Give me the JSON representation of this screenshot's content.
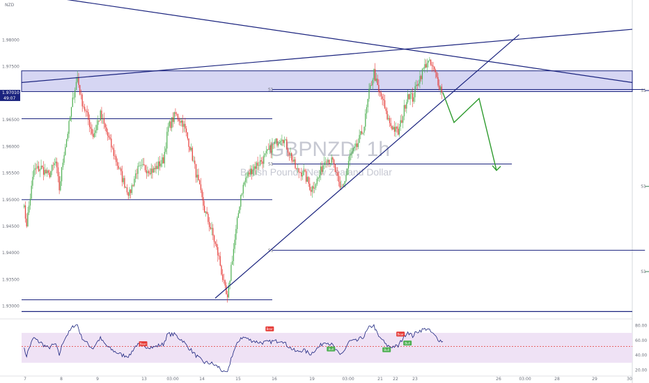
{
  "chart_data": {
    "type": "candlestick",
    "symbol": "GBPNZD, 1h",
    "description": "British Pound / New Zealand Dollar",
    "currency": "NZD",
    "price_axis": {
      "range": [
        1.928,
        1.9875
      ],
      "ticks": [
        "1.98000",
        "1.97500",
        "1.96500",
        "1.96000",
        "1.95500",
        "1.95000",
        "1.94500",
        "1.94000",
        "1.93500",
        "1.93000"
      ],
      "tick_values": [
        1.98,
        1.975,
        1.965,
        1.96,
        1.955,
        1.95,
        1.945,
        1.94,
        1.935,
        1.93
      ],
      "current_price": "1.97010",
      "current_price_value": 1.9701,
      "countdown": "49:07"
    },
    "time_axis": {
      "ticks": [
        "7",
        "8",
        "9",
        "13",
        "03:00",
        "14",
        "15",
        "16",
        "19",
        "03:00",
        "21",
        "22",
        "23",
        "26",
        "03:00",
        "28",
        "29",
        "30"
      ]
    },
    "price_path": [
      [
        0,
        1.9495
      ],
      [
        3,
        1.9455
      ],
      [
        9,
        1.9555
      ],
      [
        15,
        1.956
      ],
      [
        21,
        1.9545
      ],
      [
        27,
        1.957
      ],
      [
        30,
        1.952
      ],
      [
        34,
        1.959
      ],
      [
        38,
        1.964
      ],
      [
        42,
        1.97
      ],
      [
        45,
        1.973
      ],
      [
        48,
        1.969
      ],
      [
        54,
        1.965
      ],
      [
        58,
        1.962
      ],
      [
        64,
        1.966
      ],
      [
        70,
        1.962
      ],
      [
        76,
        1.958
      ],
      [
        82,
        1.954
      ],
      [
        88,
        1.951
      ],
      [
        94,
        1.9555
      ],
      [
        100,
        1.956
      ],
      [
        108,
        1.9555
      ],
      [
        116,
        1.9575
      ],
      [
        120,
        1.9635
      ],
      [
        126,
        1.966
      ],
      [
        132,
        1.9645
      ],
      [
        138,
        1.96
      ],
      [
        144,
        1.954
      ],
      [
        150,
        1.948
      ],
      [
        156,
        1.944
      ],
      [
        162,
        1.939
      ],
      [
        166,
        1.934
      ],
      [
        169,
        1.931
      ],
      [
        172,
        1.9375
      ],
      [
        176,
        1.944
      ],
      [
        180,
        1.951
      ],
      [
        184,
        1.954
      ],
      [
        190,
        1.956
      ],
      [
        198,
        1.9575
      ],
      [
        206,
        1.96
      ],
      [
        214,
        1.962
      ],
      [
        220,
        1.959
      ],
      [
        226,
        1.9555
      ],
      [
        232,
        1.955
      ],
      [
        238,
        1.952
      ],
      [
        244,
        1.954
      ],
      [
        250,
        1.958
      ],
      [
        256,
        1.957
      ],
      [
        262,
        1.952
      ],
      [
        266,
        1.9535
      ],
      [
        270,
        1.958
      ],
      [
        276,
        1.96
      ],
      [
        282,
        1.964
      ],
      [
        286,
        1.97
      ],
      [
        290,
        1.974
      ],
      [
        294,
        1.97
      ],
      [
        297,
        1.969
      ],
      [
        300,
        1.966
      ],
      [
        304,
        1.964
      ],
      [
        310,
        1.9625
      ],
      [
        314,
        1.966
      ],
      [
        318,
        1.97
      ],
      [
        322,
        1.969
      ],
      [
        326,
        1.972
      ],
      [
        330,
        1.974
      ],
      [
        334,
        1.976
      ],
      [
        338,
        1.975
      ],
      [
        341,
        1.9735
      ],
      [
        344,
        1.9715
      ],
      [
        347,
        1.9701
      ]
    ],
    "rsi": {
      "ylim": [
        15,
        85
      ],
      "ticks": [
        "80.00",
        "60.00",
        "40.00",
        "20.00"
      ],
      "tick_values": [
        80,
        60,
        40,
        20
      ],
      "signal_level": 52,
      "labels": [
        {
          "text": "Bear",
          "i": 95,
          "v": 55,
          "kind": "bear"
        },
        {
          "text": "Bear",
          "i": 186,
          "v": 75,
          "kind": "bear"
        },
        {
          "text": "Bull",
          "i": 230,
          "v": 48,
          "kind": "bull"
        },
        {
          "text": "Bull",
          "i": 270,
          "v": 47,
          "kind": "bull"
        },
        {
          "text": "Bear",
          "i": 280,
          "v": 68,
          "kind": "bear"
        },
        {
          "text": "Bull",
          "i": 285,
          "v": 56,
          "kind": "bull"
        }
      ]
    },
    "zones": [
      {
        "from": 1.9742,
        "to": 1.9703
      }
    ],
    "horizontal_lines": [
      {
        "y": 1.9652,
        "i1": 0,
        "i2": 100
      },
      {
        "y": 1.95,
        "i1": 0,
        "i2": 100
      },
      {
        "y": 1.9312,
        "i1": 0,
        "i2": 100
      },
      {
        "y": 1.929,
        "i1": 0,
        "i2": 500
      },
      {
        "y": 1.9567,
        "i1": 100,
        "i2": 190
      },
      {
        "y": 1.9707,
        "i1": 100,
        "i2": 240
      },
      {
        "y": 1.9405,
        "i1": 100,
        "i2": 240
      },
      {
        "y": 1.9705,
        "i1": 240,
        "i2": 380
      },
      {
        "y": 1.9525,
        "i1": 240,
        "i2": 380
      },
      {
        "y": 1.9365,
        "i1": 240,
        "i2": 380
      }
    ],
    "trendlines": [
      {
        "i1": 20,
        "v1": 1.988,
        "i2": 500,
        "v2": 1.972
      },
      {
        "i1": 0,
        "v1": 1.972,
        "i2": 500,
        "v2": 1.982
      },
      {
        "i1": 158,
        "v1": 1.9315,
        "i2": 410,
        "v2": 1.981
      }
    ],
    "projection": [
      [
        350,
        1.9701
      ],
      [
        358,
        1.9645
      ],
      [
        375,
        1.969
      ],
      [
        394,
        1.9555
      ]
    ],
    "colors": {
      "up": "#4caf50",
      "down": "#e53935",
      "trendline": "#1a237e",
      "zone": "#c5c5ee",
      "rsi_band": "#efe2f5",
      "rsi_line": "#1a237e",
      "rsi_signal": "#e53935",
      "projection": "#2e9b2e",
      "price_tag": "#1a237e",
      "level_green": "#3f7f5a"
    }
  }
}
